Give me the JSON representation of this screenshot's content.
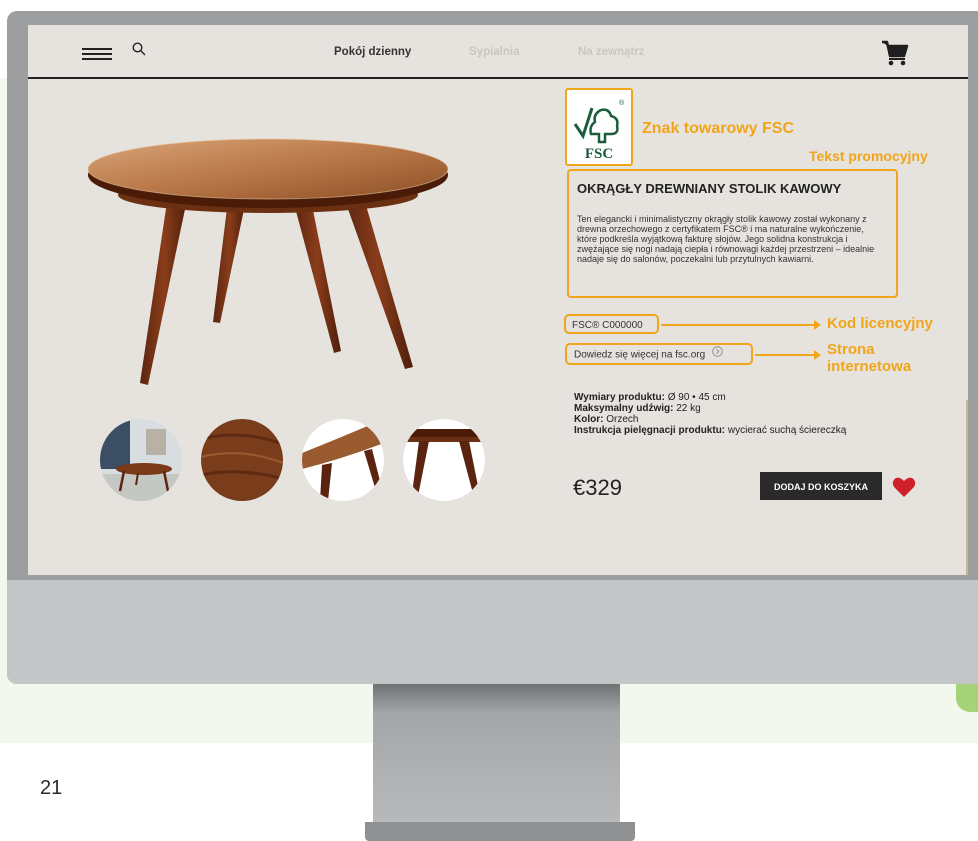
{
  "nav": {
    "links": [
      "Pokój dzienny",
      "Sypialnia",
      "Na zewnątrz"
    ]
  },
  "annotations": {
    "fsc_mark": "Znak towarowy FSC",
    "promo_text": "Tekst promocyjny",
    "license_code": "Kod licencyjny",
    "website_line1": "Strona",
    "website_line2": "internetowa"
  },
  "fsc_logo": {
    "text": "FSC",
    "registered": "®"
  },
  "product": {
    "title": "OKRĄGŁY DREWNIANY STOLIK KAWOWY",
    "description": "Ten elegancki i minimalistyczny okrągły stolik kawowy został wykonany z drewna orzechowego z certyfikatem FSC® i ma naturalne wykończenie, które podkreśla wyjątkową fakturę słojów. Jego solidna konstrukcja i zwężające się nogi nadają ciepła i równowagi każdej przestrzeni – idealnie nadaje się do salonów, poczekalni lub przytulnych kawiarni.",
    "license_code": "FSC® C000000",
    "learn_more": "Dowiedz się więcej na fsc.org",
    "specs": [
      {
        "label": "Wymiary produktu:",
        "value": " Ø 90 • 45 cm"
      },
      {
        "label": "Maksymalny udźwig:",
        "value": " 22 kg"
      },
      {
        "label": "Kolor:",
        "value": " Orzech"
      },
      {
        "label": "Instrukcja pielęgnacji produktu:",
        "value": " wycierać suchą ściereczką"
      }
    ],
    "price": "€329",
    "add_to_cart": "DODAJ DO KOSZYKA"
  },
  "page_number": "21",
  "colors": {
    "annotation": "#f0a51a",
    "screen_bg": "#e6e3de",
    "wood": "#7a3a17",
    "heart": "#d0202a"
  },
  "icons": [
    "menu-icon",
    "search-icon",
    "cart-icon",
    "chevron-right-icon",
    "heart-icon"
  ]
}
